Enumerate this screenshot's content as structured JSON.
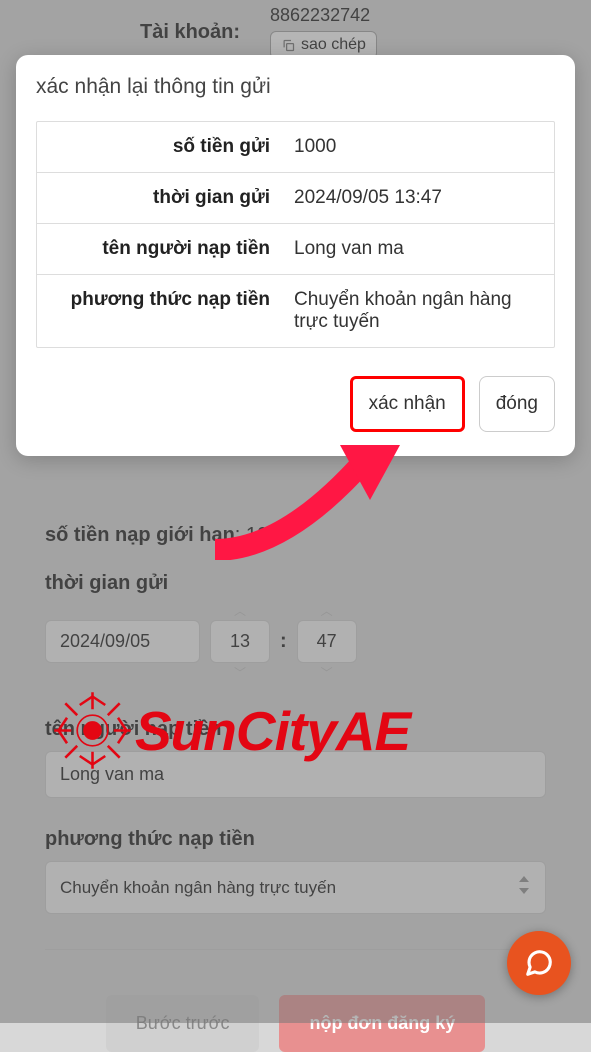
{
  "background": {
    "account_label": "Tài khoản:",
    "account_number": "8862232742",
    "copy_label": "sao chép",
    "limit_label": "số tiền nạp giới hạn",
    "limit_value": ": 100",
    "time_label": "thời gian gửi",
    "date_value": "2024/09/05",
    "hour_value": "13",
    "minute_value": "47",
    "depositor_label": "tên người nạp tiền",
    "depositor_value": "Long van ma",
    "method_label": "phương thức nạp tiền",
    "method_value": "Chuyển khoản ngân hàng trực tuyến",
    "btn_prev": "Bước trước",
    "btn_submit": "nộp đơn đăng ký"
  },
  "modal": {
    "title": "xác nhận lại thông tin gửi",
    "rows": {
      "amount_label": "số tiền gửi",
      "amount_value": "1000",
      "time_label": "thời gian gửi",
      "time_value": "2024/09/05 13:47",
      "name_label": "tên người nạp tiền",
      "name_value": "Long van ma",
      "method_label": "phương thức nạp tiền",
      "method_value": "Chuyển khoản ngân hàng trực tuyến"
    },
    "btn_confirm": "xác nhận",
    "btn_close": "đóng"
  },
  "watermark": {
    "text": "SunCityAE"
  }
}
